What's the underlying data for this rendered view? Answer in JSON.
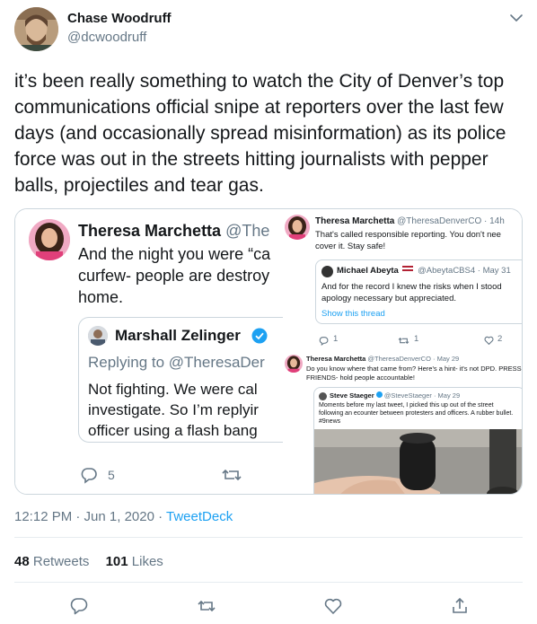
{
  "author": {
    "name": "Chase Woodruff",
    "handle": "@dcwoodruff"
  },
  "tweet_text": "it’s been really something to watch the City of Denver’s top communications official snipe at reporters over the last few days (and occasionally spread misinformation) as its police force was out in the streets hitting journalists with pepper balls, projectiles and tear gas.",
  "media": {
    "left_tweet": {
      "name": "Theresa Marchetta",
      "handle": "@The",
      "text_lines": [
        "And the night you were “ca",
        "curfew- people are destroy",
        "home."
      ],
      "quoted": {
        "name": "Marshall Zelinger",
        "replying": "Replying to @TheresaDer",
        "text_lines": [
          "Not fighting. We were cal",
          "investigate. So I’m replyir",
          "officer using a flash bang"
        ]
      },
      "reply_count": "5"
    },
    "top_right_tweet": {
      "name": "Theresa Marchetta",
      "handle_time": "@TheresaDenverCO · 14h",
      "text_lines": [
        "That's called responsible reporting. You don't nee",
        "cover it. Stay safe!"
      ],
      "quoted": {
        "name": "Michael Abeyta",
        "handle_time": "@AbeytaCBS4 · May 31",
        "text_lines": [
          "And for the record I knew the risks when I stood",
          "apology necessary but appreciated."
        ],
        "show_thread": "Show this thread"
      },
      "reply_count": "1",
      "retweet_count": "1",
      "like_count": "2"
    },
    "bottom_right_tweet": {
      "name": "Theresa Marchetta",
      "handle_time": "@TheresaDenverCO · May 29",
      "text_lines": [
        "Do you know where that came from? Here's a hint- it's not DPD. PRESS",
        "FRIENDS- hold people accountable!"
      ],
      "quoted": {
        "name": "Steve Staeger",
        "handle_time": "@SteveStaeger · May 29",
        "text_lines": [
          "Moments before my last tweet, I picked this up out of the street",
          "following an ecounter between protesters and officers. A rubber bullet.",
          "#9news"
        ]
      }
    }
  },
  "timestamp": "12:12 PM · Jun 1, 2020 · ",
  "source": "TweetDeck",
  "stats": {
    "retweets_count": "48",
    "retweets_label": "Retweets",
    "likes_count": "101",
    "likes_label": "Likes"
  },
  "colors": {
    "text": "#14171a",
    "secondary": "#657786",
    "accent": "#1da1f2",
    "border": "#e6ecf0"
  },
  "icons": [
    "caret-down-icon",
    "verified-icon",
    "reply-icon",
    "retweet-icon",
    "like-icon",
    "share-icon"
  ]
}
